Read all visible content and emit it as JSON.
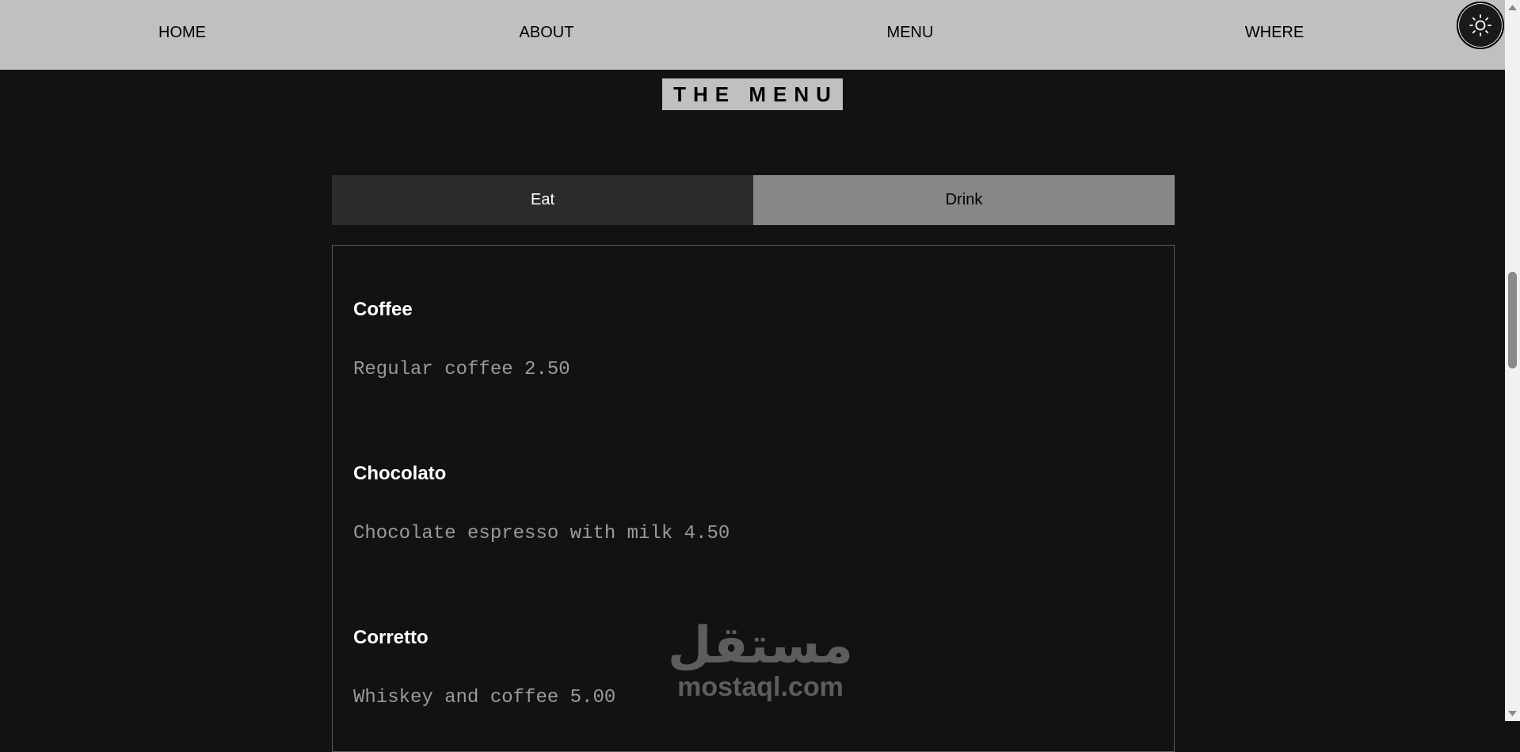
{
  "nav": {
    "items": [
      "HOME",
      "ABOUT",
      "MENU",
      "WHERE"
    ],
    "theme_toggle_icon": "sun-icon"
  },
  "page": {
    "title": "THE MENU"
  },
  "tabs": [
    {
      "label": "Eat",
      "active": false
    },
    {
      "label": "Drink",
      "active": true
    }
  ],
  "menu": {
    "items": [
      {
        "name": "Coffee",
        "description": "Regular coffee 2.50"
      },
      {
        "name": "Chocolato",
        "description": "Chocolate espresso with milk 4.50"
      },
      {
        "name": "Corretto",
        "description": "Whiskey and coffee 5.00"
      }
    ]
  },
  "watermark": {
    "arabic": "مستقل",
    "latin": "mostaql.com"
  },
  "colors": {
    "background": "#121212",
    "navbar": "#c0c0c0",
    "tab_eat": "#2b2b2b",
    "tab_drink": "#878787",
    "item_name": "#ffffff",
    "item_desc": "#9a9a9a"
  }
}
